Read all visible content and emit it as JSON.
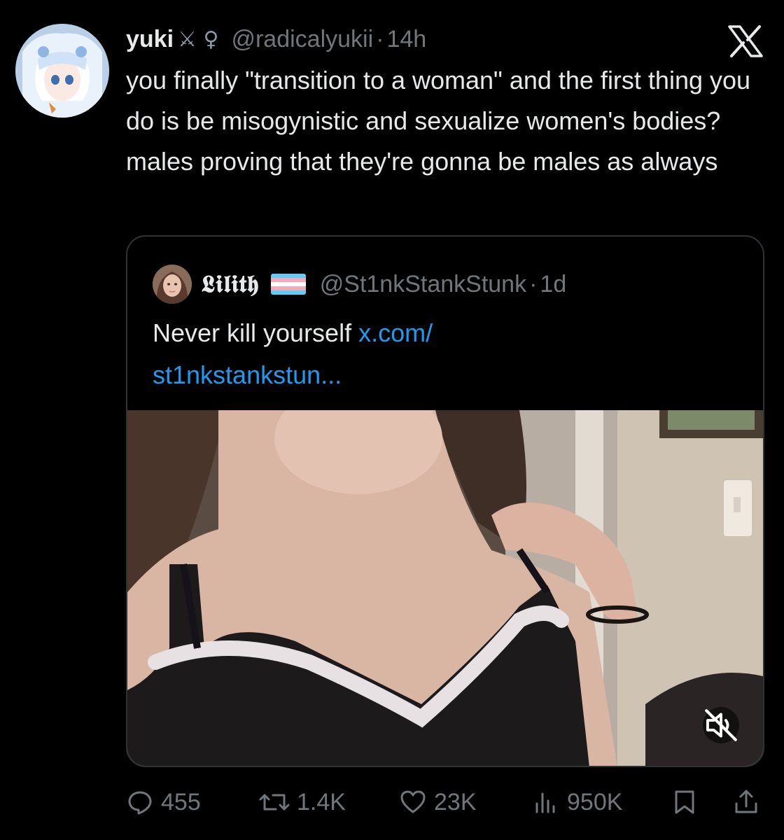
{
  "tweet": {
    "author_name": "yuki",
    "author_emoji": "⚔ ♀",
    "handle": "@radicalyukii",
    "separator": "·",
    "time": "14h",
    "text": "you finally \"transition to a woman\" and the first thing you do is be misogynistic and sexualize women's bodies? males proving that they're gonna be males as always"
  },
  "quoted": {
    "author_name": "𝕷𝖎𝖑𝖎𝖙𝖍",
    "handle": "@St1nkStankStunk",
    "separator": "·",
    "time": "1d",
    "text": "Never kill yourself ",
    "link_line1": "x.com/",
    "link_line2": "st1nkstankstun...",
    "flag_colors": [
      "#5BCEFA",
      "#F5A9B8",
      "#FFFFFF",
      "#F5A9B8",
      "#5BCEFA"
    ]
  },
  "actions": {
    "replies": "455",
    "reposts": "1.4K",
    "likes": "23K",
    "views": "950K"
  },
  "colors": {
    "background": "#000000",
    "text": "#e7e9ea",
    "muted": "#71767b",
    "link": "#1d9bf0",
    "border": "#2f3336"
  }
}
